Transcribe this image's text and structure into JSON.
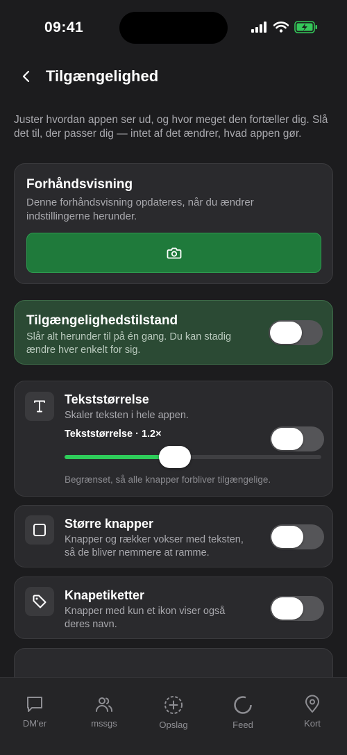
{
  "status_bar": {
    "time": "09:41",
    "icons": [
      "signal-bars-icon",
      "wifi-icon",
      "battery-charging-icon"
    ],
    "battery_color": "#34c759"
  },
  "header": {
    "back_icon": "chevron-left-icon",
    "title": "Tilgængelighed"
  },
  "intro": "Juster hvordan appen ser ud, og hvor meget den fortæller dig. Slå det til, der passer dig — intet af det ændrer, hvad appen gør.",
  "preview": {
    "title": "Forhåndsvisning",
    "description": "Denne forhåndsvisning opdateres, når du ændrer indstillingerne herunder.",
    "icon": "camera-icon",
    "box_color": "#1f7a3b"
  },
  "accessibility_mode": {
    "title": "Tilgængelighedstilstand",
    "description": "Slår alt herunder til på én gang. Du kan stadig ændre hver enkelt for sig.",
    "enabled": false
  },
  "settings": {
    "text_size": {
      "icon": "text-t-icon",
      "title": "Tekststørrelse",
      "description": "Skaler teksten i hele appen.",
      "slider_label": "Tekststørrelse · 1.2×",
      "slider_fraction": 0.43,
      "note": "Begrænset, så alle knapper forbliver tilgængelige.",
      "enabled": false,
      "accent_color": "#2ecc5a"
    },
    "bigger_buttons": {
      "icon": "square-icon",
      "title": "Større knapper",
      "description": "Knapper og rækker vokser med teksten, så de bliver nemmere at ramme.",
      "enabled": false
    },
    "button_labels": {
      "icon": "tag-icon",
      "title": "Knapetiketter",
      "description": "Knapper med kun et ikon viser også deres navn.",
      "enabled": false
    }
  },
  "tab_bar": {
    "tabs": [
      {
        "label": "DM'er",
        "icon": "chat-bubble-icon"
      },
      {
        "label": "mssgs",
        "icon": "people-icon"
      },
      {
        "label": "Opslag",
        "icon": "plus-circle-icon"
      },
      {
        "label": "Feed",
        "icon": "circle-icon"
      },
      {
        "label": "Kort",
        "icon": "map-pin-icon"
      }
    ]
  }
}
